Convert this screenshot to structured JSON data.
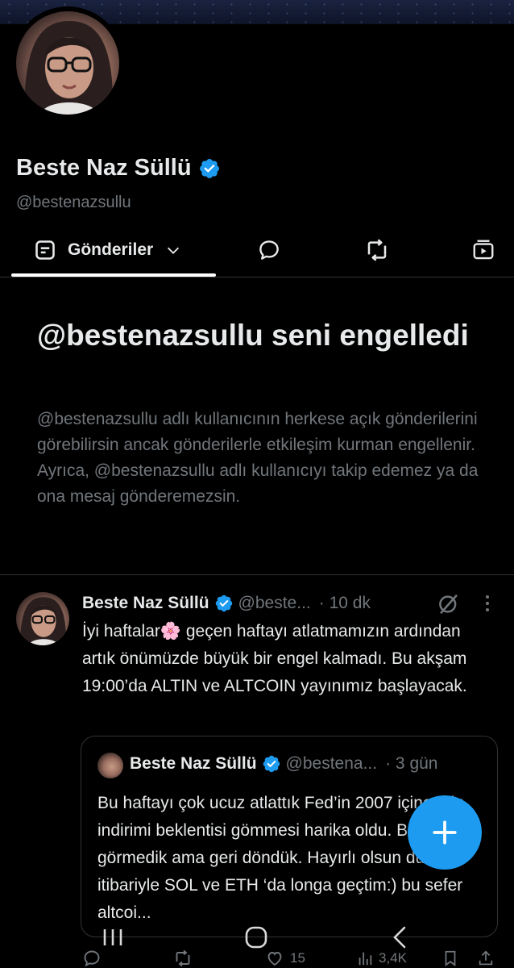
{
  "profile": {
    "display_name": "Beste Naz Süllü",
    "handle": "@bestenazsullu"
  },
  "tabs": {
    "posts_label": "Gönderiler"
  },
  "blocked": {
    "title": "@bestenazsullu seni engelledi",
    "description": "@bestenazsullu adlı kullanıcının herkese açık gönderilerini görebilirsin ancak gönderilerle etkileşim kurman engellenir. Ayrıca, @bestenazsullu adlı kullanıcıyı takip edemez ya da ona mesaj gönderemezsin."
  },
  "post": {
    "author": "Beste Naz Süllü",
    "handle": "@beste...",
    "time": "· 10 dk",
    "text": "İyi haftalar🌸 geçen haftayı atlatmamızın ardından artık önümüzde büyük bir engel kalmadı. Bu akşam 19:00’da ALTIN ve ALTCOIN yayınımız başlayacak.",
    "quote": {
      "author": "Beste Naz Süllü",
      "handle": "@bestena...",
      "time": "· 3 gün",
      "text": "Bu haftayı çok ucuz atlattık Fed’in 2007 içine faiz indirimi beklentisi gömmesi harika oldu. Belki 72 görmedik ama geri döndük. Hayırlı olsun dün itibariyle SOL ve ETH ‘da longa geçtim:) bu sefer altcoi..."
    },
    "actions": {
      "likes": "15",
      "views": "3,4K"
    }
  },
  "colors": {
    "accent": "#1d9bf0",
    "background": "#000000",
    "text_primary": "#e7e9ea",
    "text_secondary": "#71767b",
    "border": "#2f3336"
  }
}
